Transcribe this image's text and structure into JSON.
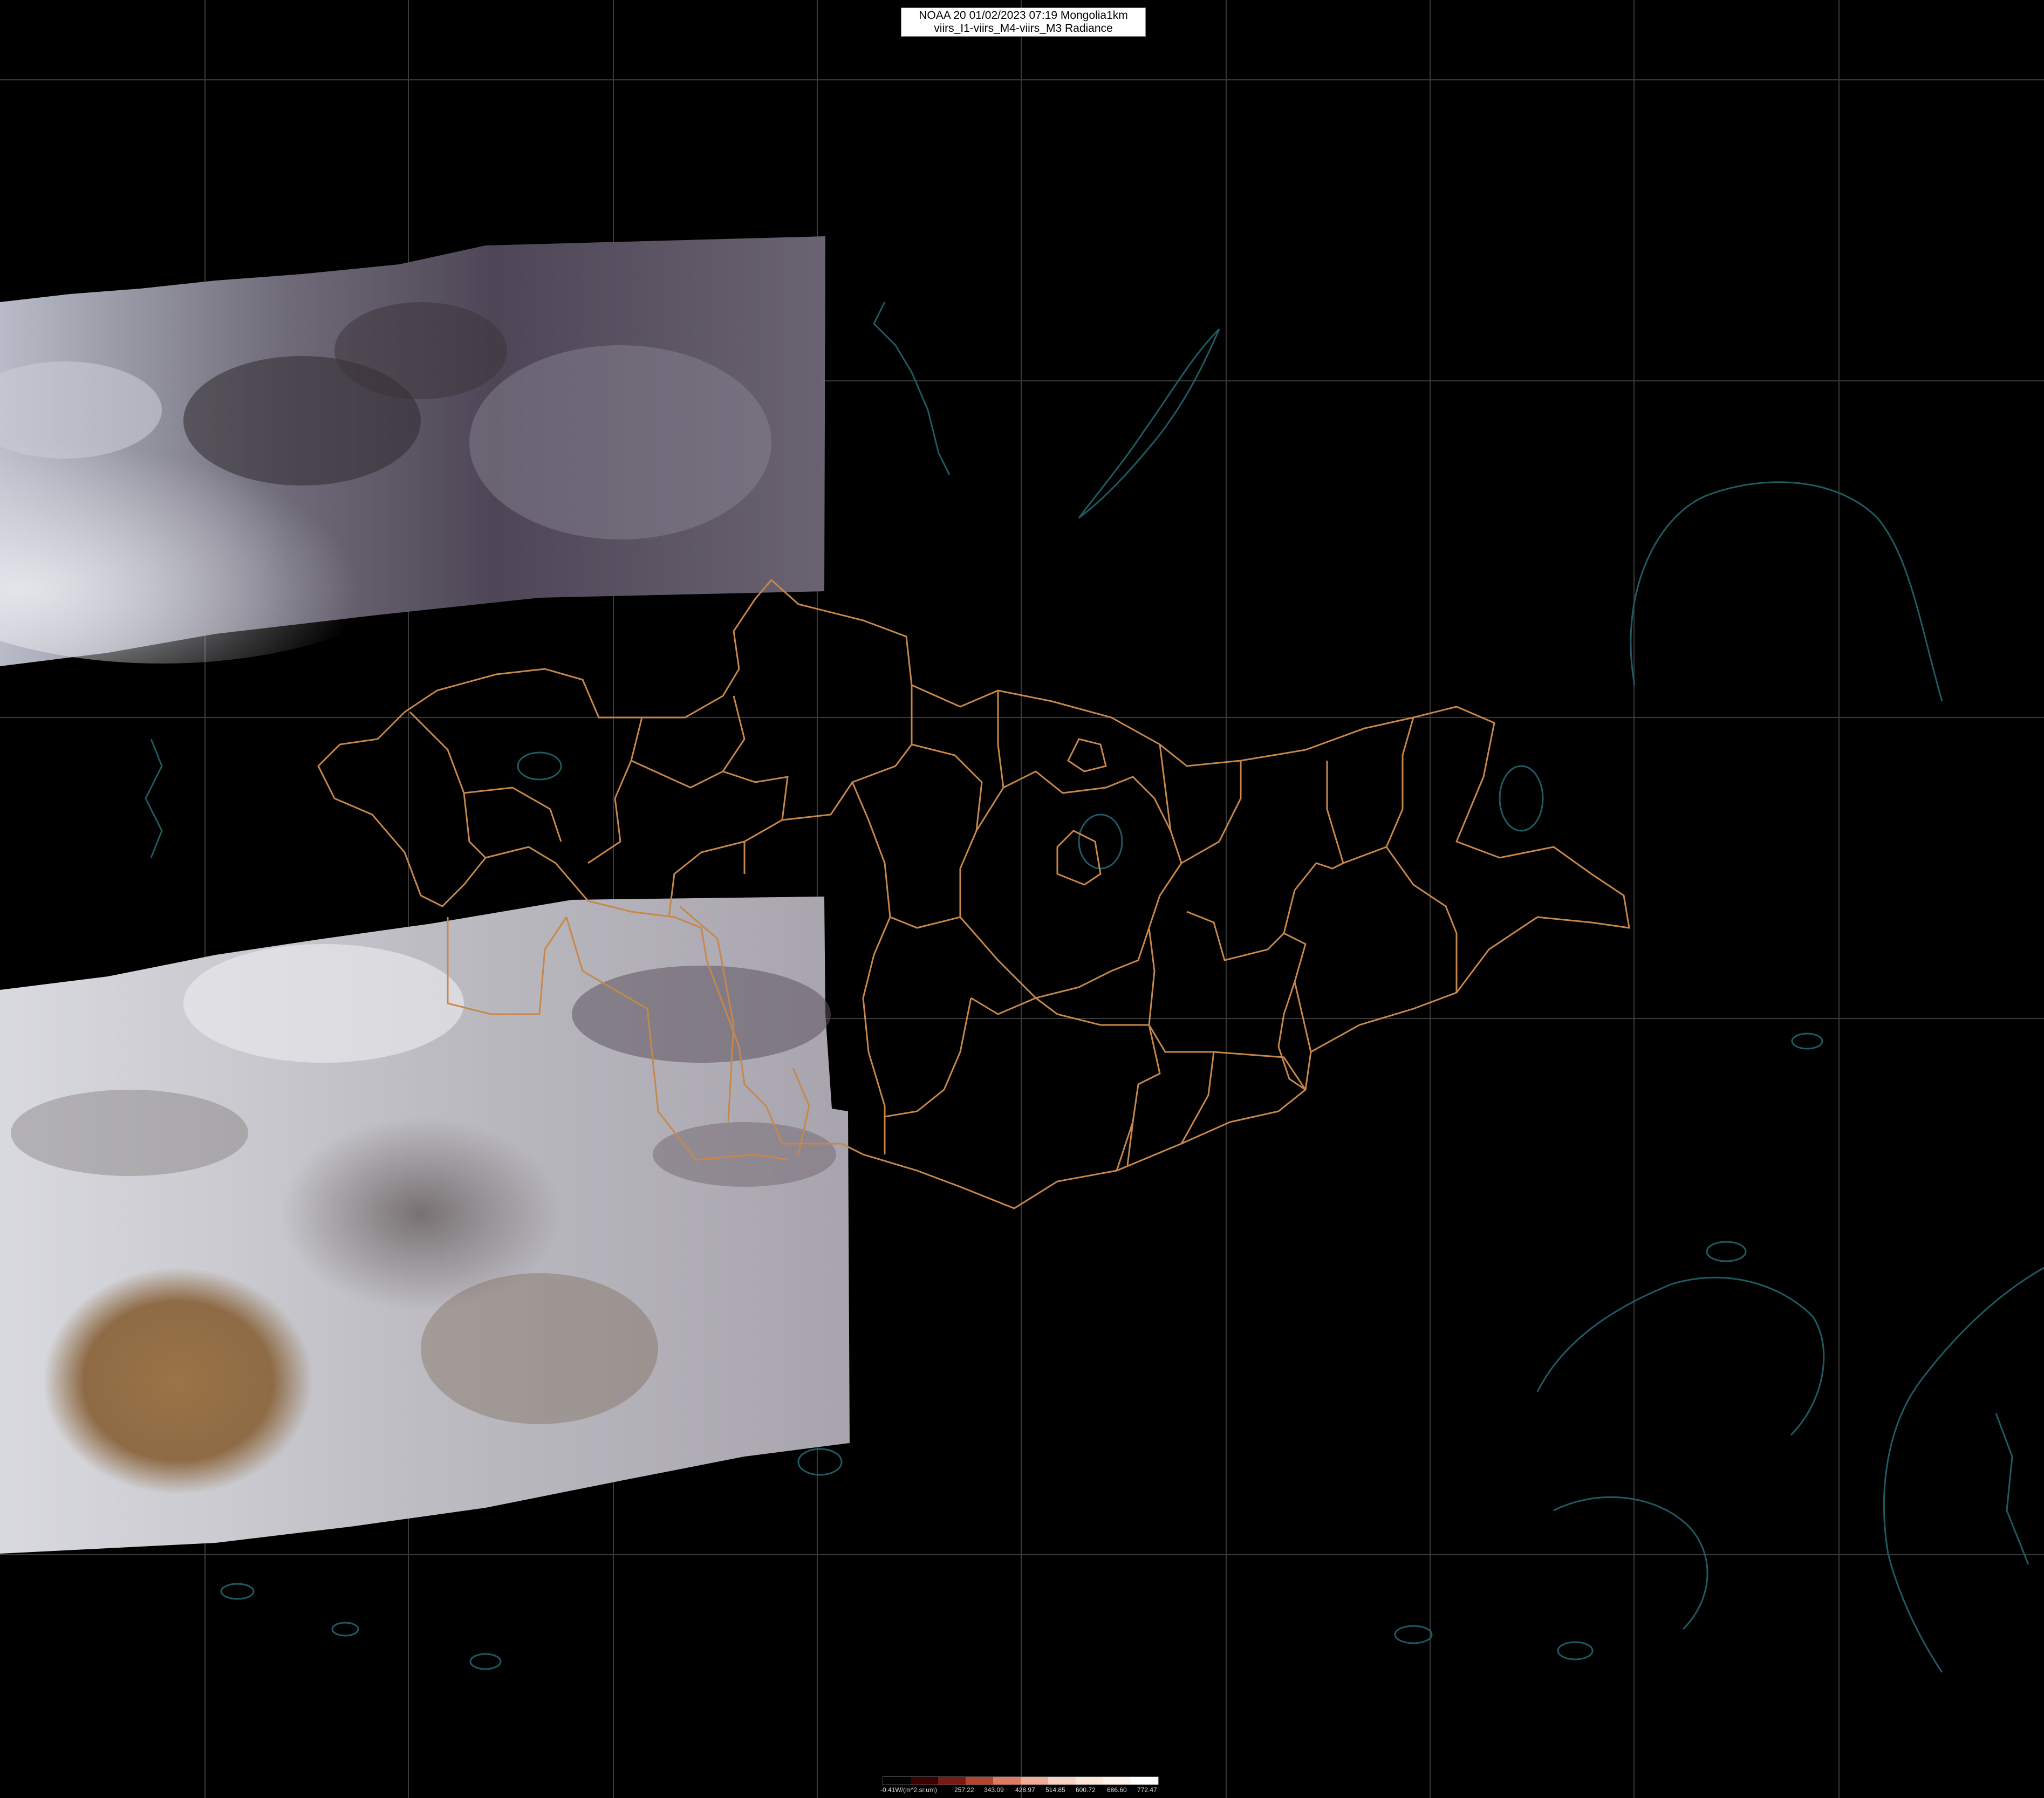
{
  "header": {
    "line1": "NOAA 20 01/02/2023 07:19 Mongolia1km",
    "line2": "viirs_I1-viirs_M4-viirs_M3 Radiance"
  },
  "legend": {
    "ticks": [
      "-0.41W/(m^2.sr.um)",
      "257.22",
      "343.09",
      "428.97",
      "514.85",
      "600.72",
      "686.60",
      "772.47"
    ],
    "colors": [
      "#000000",
      "#3a0000",
      "#7a1a12",
      "#b5432f",
      "#e07b62",
      "#f2ac95",
      "#f8d2c2",
      "#fbe8dc",
      "#fdf3ea",
      "#ffffff"
    ]
  },
  "map": {
    "background": "#000000",
    "grid_color": "#3a3a3a",
    "border_color": "#c8874a",
    "coast_color": "#1f5a63"
  }
}
